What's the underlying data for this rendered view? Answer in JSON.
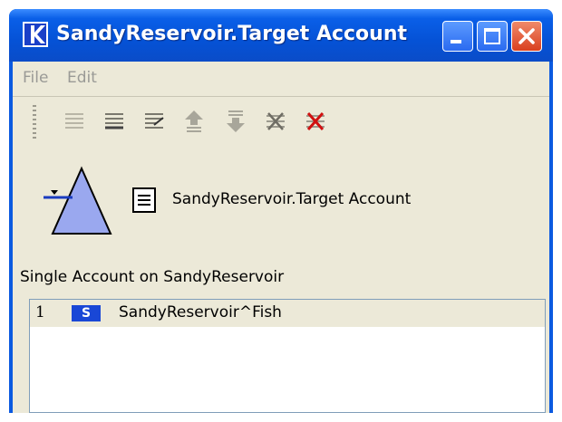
{
  "window": {
    "title": "SandyReservoir.Target Account",
    "colors": {
      "titlebar": "#0552d6",
      "client": "#ece9d8",
      "close": "#d9401f"
    }
  },
  "menu": {
    "items": [
      {
        "label": "File"
      },
      {
        "label": "Edit"
      }
    ]
  },
  "toolbar": {
    "tools": [
      {
        "icon": "list-icon",
        "enabled": false
      },
      {
        "icon": "list-dark-icon",
        "enabled": true
      },
      {
        "icon": "edit-list-icon",
        "enabled": true
      },
      {
        "icon": "move-up-icon",
        "enabled": true
      },
      {
        "icon": "move-down-icon",
        "enabled": true
      },
      {
        "icon": "delete-icon",
        "enabled": true
      },
      {
        "icon": "delete-red-icon",
        "enabled": true
      }
    ]
  },
  "object": {
    "icon": "reservoir-triangle-icon",
    "label": "SandyReservoir.Target Account"
  },
  "section": {
    "label": "Single Account on SandyReservoir"
  },
  "accounts": [
    {
      "index": "1",
      "type": "S",
      "name": "SandyReservoir^Fish"
    }
  ]
}
